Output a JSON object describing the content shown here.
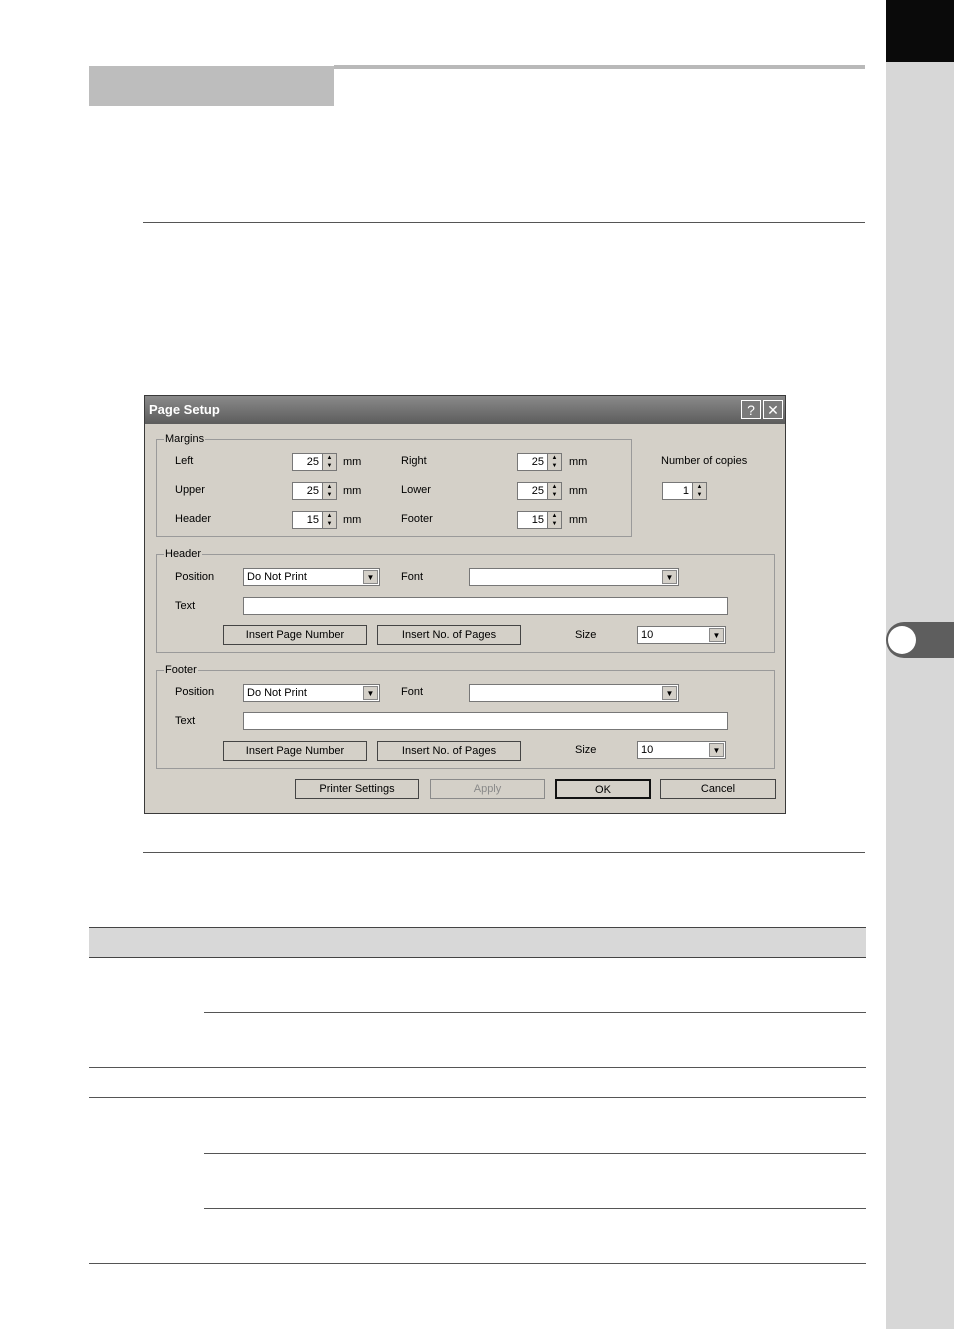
{
  "dialog": {
    "title": "Page Setup",
    "help_label": "?",
    "close_label": "✕",
    "margins": {
      "group_label": "Margins",
      "left_label": "Left",
      "left_value": "25",
      "upper_label": "Upper",
      "upper_value": "25",
      "header_label": "Header",
      "header_value": "15",
      "right_label": "Right",
      "right_value": "25",
      "lower_label": "Lower",
      "lower_value": "25",
      "footer_label": "Footer",
      "footer_value": "15",
      "unit": "mm"
    },
    "copies": {
      "label": "Number of copies",
      "value": "1"
    },
    "header": {
      "group_label": "Header",
      "position_label": "Position",
      "position_value": "Do Not Print",
      "font_label": "Font",
      "font_value": "",
      "text_label": "Text",
      "text_value": "",
      "insert_page_number": "Insert Page Number",
      "insert_no_pages": "Insert No. of Pages",
      "size_label": "Size",
      "size_value": "10"
    },
    "footer": {
      "group_label": "Footer",
      "position_label": "Position",
      "position_value": "Do Not Print",
      "font_label": "Font",
      "font_value": "",
      "text_label": "Text",
      "text_value": "",
      "insert_page_number": "Insert Page Number",
      "insert_no_pages": "Insert No. of Pages",
      "size_label": "Size",
      "size_value": "10"
    },
    "buttons": {
      "printer_settings": "Printer Settings",
      "apply": "Apply",
      "ok": "OK",
      "cancel": "Cancel"
    }
  }
}
